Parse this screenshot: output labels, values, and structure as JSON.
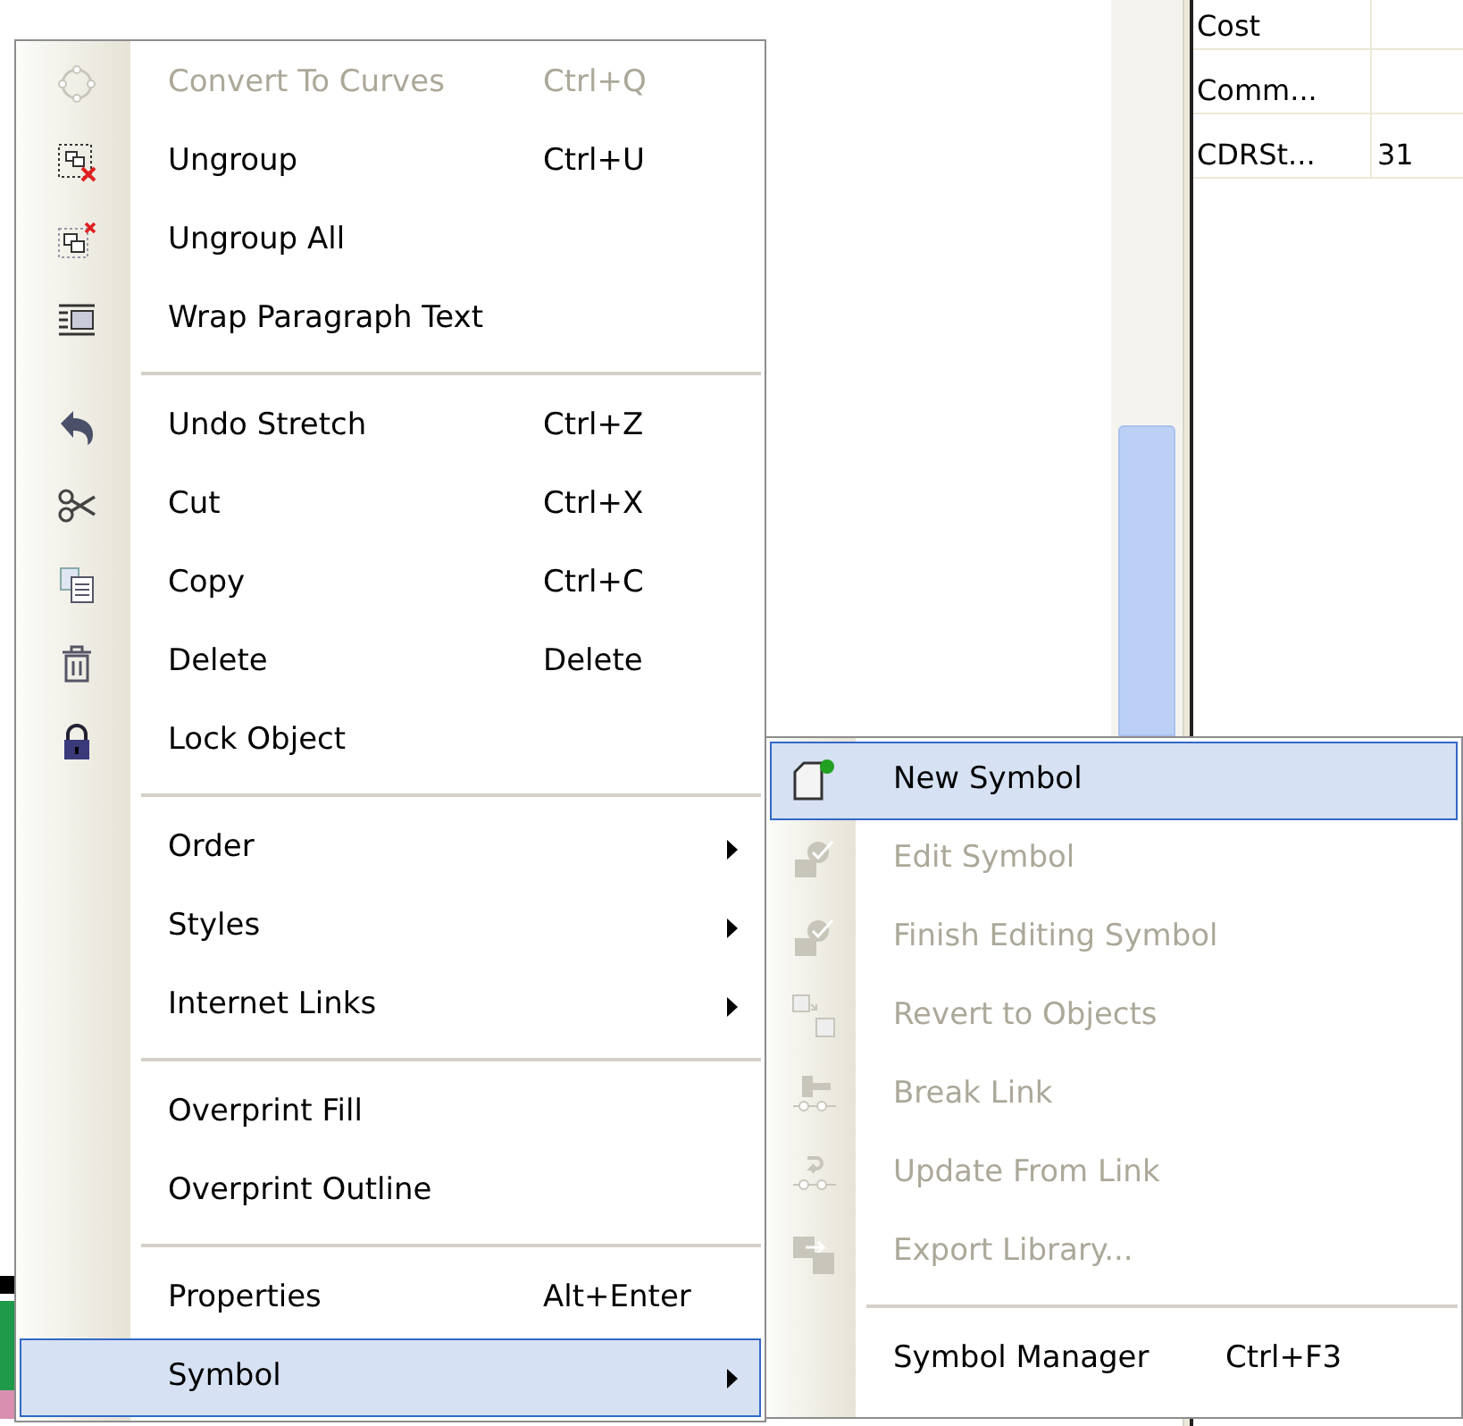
{
  "properties_table": {
    "rows": [
      {
        "column_1": "Cost"
      },
      {
        "column_1": "Comm..."
      },
      {
        "column_1": "CDRSt...",
        "column_2": "31"
      }
    ]
  },
  "context_menu": {
    "groups": [
      [
        {
          "label": "Convert To Curves",
          "shortcut": "Ctrl+Q",
          "disabled": true,
          "submenu": false,
          "selected": false
        },
        {
          "label": "Ungroup",
          "shortcut": "Ctrl+U",
          "disabled": false,
          "submenu": false,
          "selected": false
        },
        {
          "label": "Ungroup All",
          "disabled": false,
          "submenu": false,
          "selected": false
        },
        {
          "label": "Wrap Paragraph Text",
          "disabled": false,
          "submenu": false,
          "selected": false
        }
      ],
      [
        {
          "label": "Undo Stretch",
          "shortcut": "Ctrl+Z",
          "disabled": false,
          "submenu": false,
          "selected": false
        },
        {
          "label": "Cut",
          "shortcut": "Ctrl+X",
          "disabled": false,
          "submenu": false,
          "selected": false
        },
        {
          "label": "Copy",
          "shortcut": "Ctrl+C",
          "disabled": false,
          "submenu": false,
          "selected": false
        },
        {
          "label": "Delete",
          "shortcut": "Delete",
          "disabled": false,
          "submenu": false,
          "selected": false
        },
        {
          "label": "Lock Object",
          "disabled": false,
          "submenu": false,
          "selected": false
        }
      ],
      [
        {
          "label": "Order",
          "disabled": false,
          "submenu": true,
          "selected": false
        },
        {
          "label": "Styles",
          "disabled": false,
          "submenu": true,
          "selected": false
        },
        {
          "label": "Internet Links",
          "disabled": false,
          "submenu": true,
          "selected": false
        }
      ],
      [
        {
          "label": "Overprint Fill",
          "disabled": false,
          "submenu": false,
          "selected": false
        },
        {
          "label": "Overprint Outline",
          "disabled": false,
          "submenu": false,
          "selected": false
        }
      ],
      [
        {
          "label": "Properties",
          "shortcut": "Alt+Enter",
          "disabled": false,
          "submenu": false,
          "selected": false
        },
        {
          "label": "Symbol",
          "disabled": false,
          "submenu": true,
          "selected": true
        }
      ]
    ]
  },
  "symbol_submenu": {
    "groups": [
      [
        {
          "label": "New Symbol",
          "disabled": false,
          "selected": true
        },
        {
          "label": "Edit Symbol",
          "disabled": true,
          "selected": false
        },
        {
          "label": "Finish Editing Symbol",
          "disabled": true,
          "selected": false
        },
        {
          "label": "Revert to Objects",
          "disabled": true,
          "selected": false
        },
        {
          "label": "Break Link",
          "disabled": true,
          "selected": false
        },
        {
          "label": "Update From Link",
          "disabled": true,
          "selected": false
        },
        {
          "label": "Export Library...",
          "disabled": true,
          "selected": false
        }
      ],
      [
        {
          "label": "Symbol Manager",
          "shortcut": "Ctrl+F3",
          "disabled": false,
          "selected": false
        }
      ]
    ]
  }
}
